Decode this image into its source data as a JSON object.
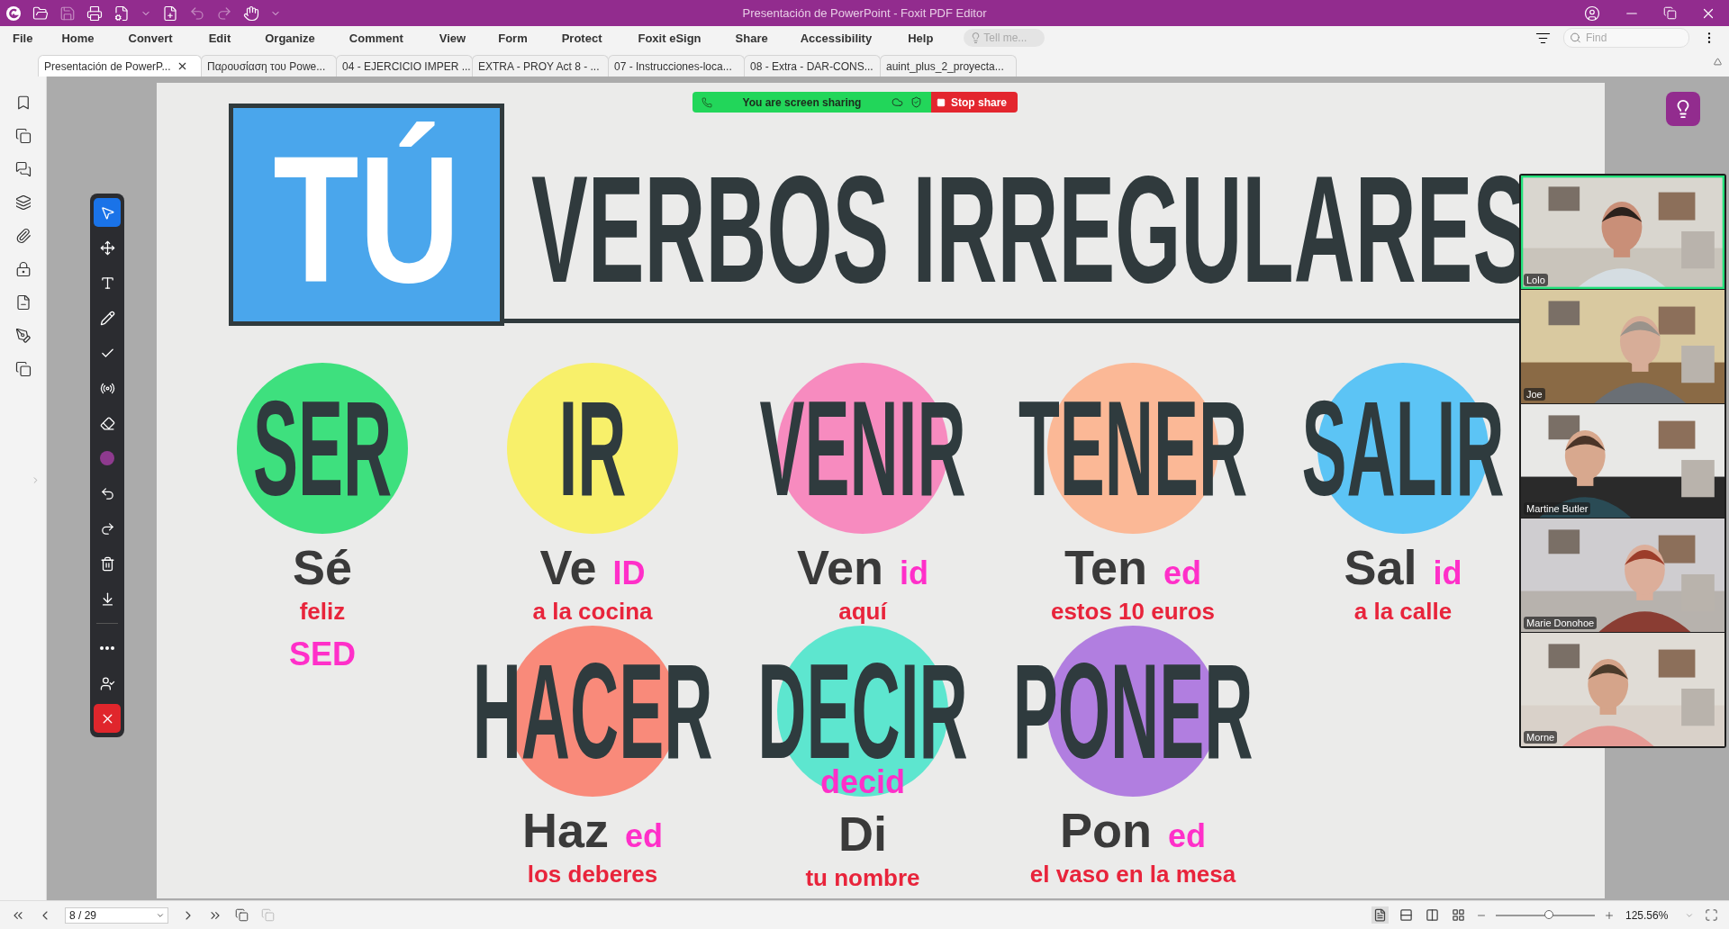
{
  "window": {
    "title": "Presentación de PowerPoint - Foxit PDF Editor"
  },
  "menu": [
    "File",
    "Home",
    "Convert",
    "Edit",
    "Organize",
    "Comment",
    "View",
    "Form",
    "Protect",
    "Foxit eSign",
    "Share",
    "Accessibility",
    "Help"
  ],
  "tell_me": {
    "placeholder": "Tell me..."
  },
  "find": {
    "placeholder": "Find"
  },
  "tabs": [
    {
      "label": "Presentación de PowerP...",
      "selected": true
    },
    {
      "label": "Παρουσίαση του Powe...",
      "selected": false
    },
    {
      "label": "04 - EJERCICIO IMPER ...",
      "selected": false
    },
    {
      "label": "EXTRA - PROY Act 8 - ...",
      "selected": false
    },
    {
      "label": "07 - Instrucciones-loca...",
      "selected": false
    },
    {
      "label": "08 - Extra - DAR-CONS...",
      "selected": false
    },
    {
      "label": "auint_plus_2_proyecta...",
      "selected": false
    }
  ],
  "share_bar": {
    "status": "You are screen sharing",
    "stop_button": "Stop share"
  },
  "annotation_tools": [
    {
      "kind": "select",
      "selected": true
    },
    {
      "kind": "move",
      "selected": false
    },
    {
      "kind": "text",
      "selected": false
    },
    {
      "kind": "pen",
      "selected": false
    },
    {
      "kind": "check",
      "selected": false
    },
    {
      "kind": "spotlight",
      "selected": false
    },
    {
      "kind": "eraser",
      "selected": false
    },
    {
      "kind": "color",
      "selected": false
    },
    {
      "kind": "undo",
      "selected": false
    },
    {
      "kind": "redo",
      "selected": false
    },
    {
      "kind": "delete",
      "selected": false
    },
    {
      "kind": "save",
      "selected": false
    }
  ],
  "annotation_extra": [
    {
      "kind": "more"
    },
    {
      "kind": "user"
    },
    {
      "kind": "close"
    }
  ],
  "slide": {
    "badge": "TÚ",
    "title": "VERBOS IRREGULARES",
    "rows": [
      [
        {
          "infinitive": "SER",
          "color": "#3ee07e",
          "lines": [
            {
              "kind": "form",
              "text": "Sé"
            },
            {
              "kind": "phrase",
              "text": "feliz"
            },
            {
              "kind": "ink",
              "text": "SED"
            }
          ]
        },
        {
          "infinitive": "IR",
          "color": "#f8f06a",
          "lines": [
            {
              "kind": "form",
              "text": "Ve",
              "suffix": "ID"
            },
            {
              "kind": "phrase",
              "text": "a la cocina"
            }
          ]
        },
        {
          "infinitive": "VENIR",
          "color": "#f78bbf",
          "lines": [
            {
              "kind": "form",
              "text": "Ven",
              "suffix": "id"
            },
            {
              "kind": "phrase",
              "text": "aquí"
            }
          ]
        },
        {
          "infinitive": "TENER",
          "color": "#fbb896",
          "lines": [
            {
              "kind": "form",
              "text": "Ten",
              "suffix": "ed"
            },
            {
              "kind": "phrase",
              "text": "estos 10 euros"
            }
          ]
        },
        {
          "infinitive": "SALIR",
          "color": "#5cc4f5",
          "lines": [
            {
              "kind": "form",
              "text": "Sal",
              "suffix": "id"
            },
            {
              "kind": "phrase",
              "text": "a la calle"
            }
          ]
        }
      ],
      [
        "",
        {
          "infinitive": "HACER",
          "color": "#f98a7a",
          "lines": [
            {
              "kind": "form",
              "text": "Haz",
              "suffix": "ed"
            },
            {
              "kind": "phrase",
              "text": "los deberes"
            }
          ]
        },
        {
          "infinitive": "DECIR",
          "color": "#5de6cf",
          "lines": [
            {
              "kind": "ink",
              "text": "decid"
            },
            {
              "kind": "form",
              "text": "Di"
            },
            {
              "kind": "phrase",
              "text": "tu nombre"
            }
          ]
        },
        {
          "infinitive": "PONER",
          "color": "#b17ee0",
          "lines": [
            {
              "kind": "form",
              "text": "Pon",
              "suffix": "ed"
            },
            {
              "kind": "phrase",
              "text": "el vaso en la mesa"
            }
          ]
        }
      ]
    ]
  },
  "participants": [
    {
      "name": "Lolo",
      "speaking": true
    },
    {
      "name": "Joe",
      "speaking": false
    },
    {
      "name": "Martine Butler",
      "speaking": false
    },
    {
      "name": "Marie Donohoe",
      "speaking": false
    },
    {
      "name": "Morne",
      "speaking": false
    }
  ],
  "page_nav": {
    "page": "8 / 29"
  },
  "zoom": {
    "level": 0.54,
    "value": "125.56%"
  }
}
